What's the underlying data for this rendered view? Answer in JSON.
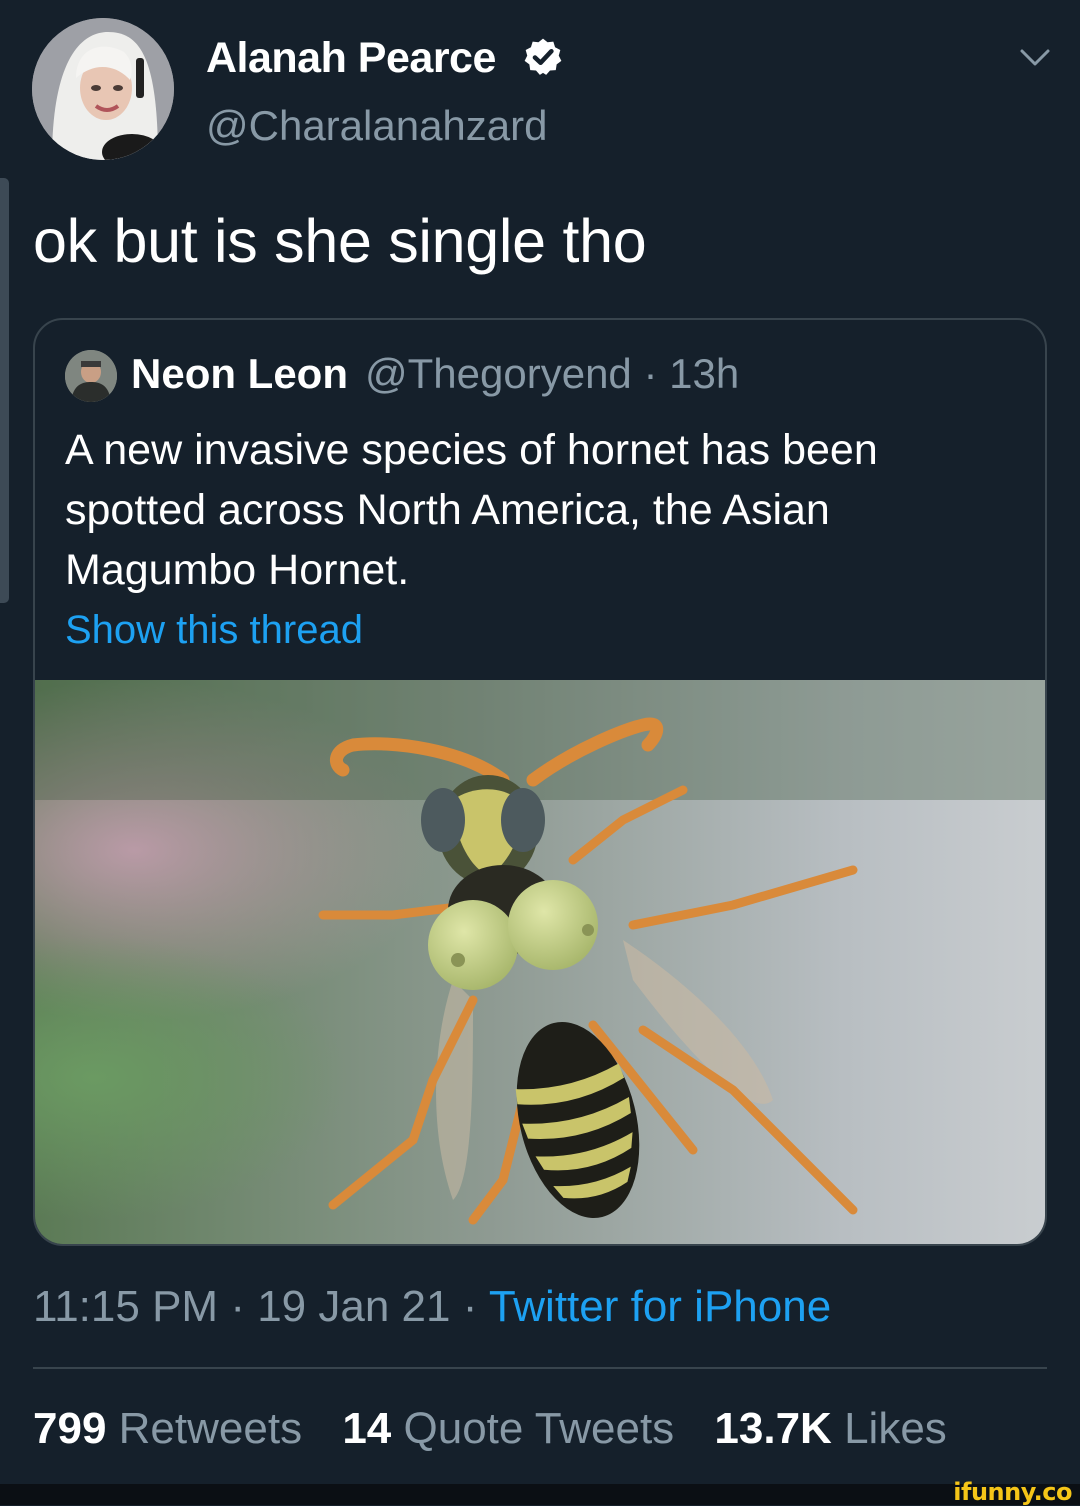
{
  "tweet": {
    "author_name": "Alanah Pearce",
    "author_handle": "@Charalanahzard",
    "text": "ok but is she single tho",
    "timestamp": "11:15 PM",
    "date": "19 Jan 21",
    "source": "Twitter for iPhone"
  },
  "quote": {
    "author_name": "Neon Leon",
    "author_handle": "@Thegoryend",
    "age": "13h",
    "text": "A new invasive species of hornet has been spotted across North America, the Asian Magumbo Hornet.",
    "show_thread": "Show this thread"
  },
  "stats": {
    "retweets_count": "799",
    "retweets_label": "Retweets",
    "quotes_count": "14",
    "quotes_label": "Quote Tweets",
    "likes_count": "13.7K",
    "likes_label": "Likes"
  },
  "separator": "·",
  "watermark": "ifunny.co",
  "colors": {
    "background": "#15202b",
    "accent": "#1da1f2",
    "muted": "#8899a6",
    "border": "#38444d"
  }
}
